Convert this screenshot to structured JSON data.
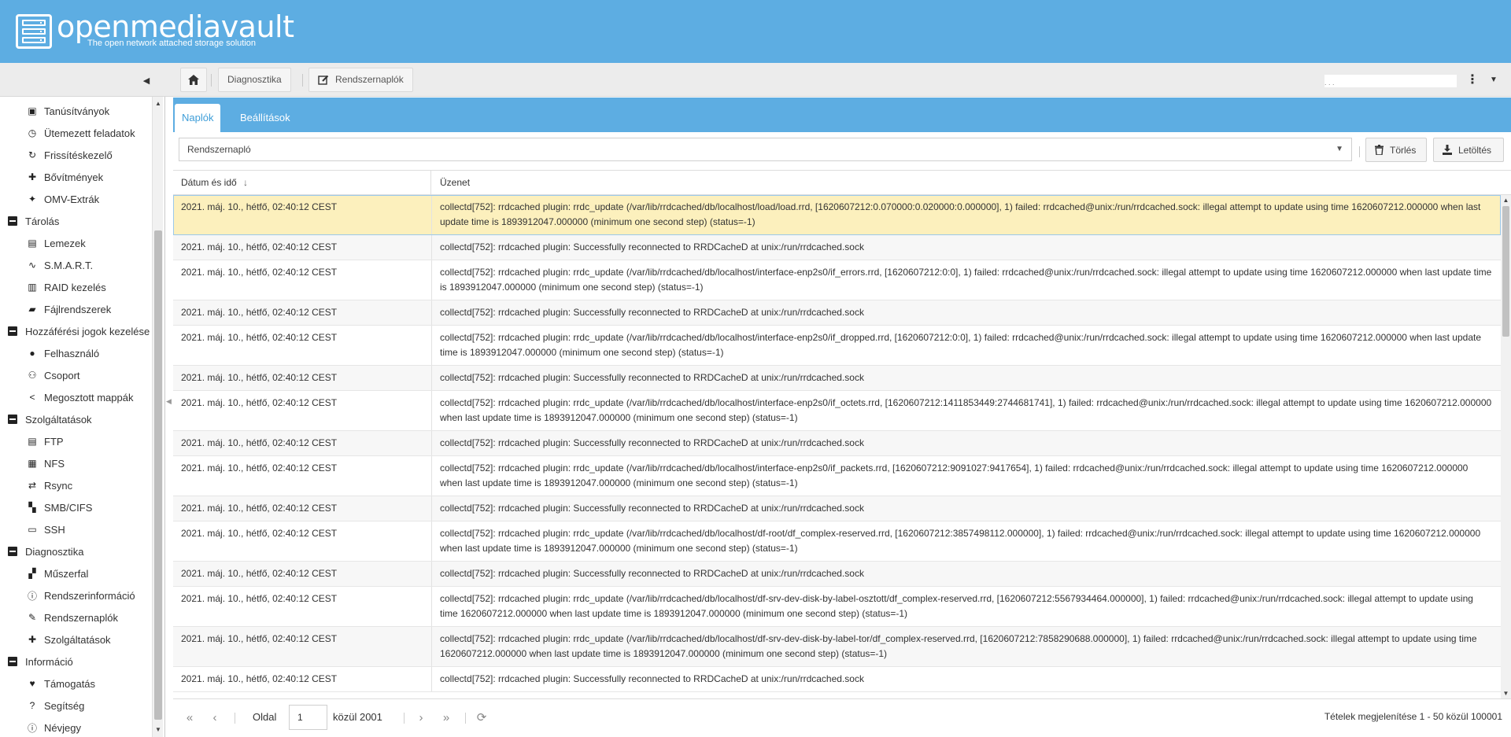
{
  "brand": {
    "name": "openmediavault",
    "tagline": "The open network attached storage solution"
  },
  "breadcrumb": [
    "Diagnosztika",
    "Rendszernaplók"
  ],
  "user": {
    "display": ". .                                            ."
  },
  "sidebar": {
    "items": [
      {
        "type": "child",
        "label": "Tanúsítványok",
        "icon": "certificate-icon"
      },
      {
        "type": "child",
        "label": "Ütemezett feladatok",
        "icon": "calendar-clock-icon"
      },
      {
        "type": "child",
        "label": "Frissítéskezelő",
        "icon": "refresh-icon"
      },
      {
        "type": "child",
        "label": "Bővítmények",
        "icon": "puzzle-icon"
      },
      {
        "type": "child",
        "label": "OMV-Extrák",
        "icon": "wand-icon"
      },
      {
        "type": "group",
        "label": "Tárolás"
      },
      {
        "type": "child",
        "label": "Lemezek",
        "icon": "disk-icon"
      },
      {
        "type": "child",
        "label": "S.M.A.R.T.",
        "icon": "pulse-icon"
      },
      {
        "type": "child",
        "label": "RAID kezelés",
        "icon": "raid-icon"
      },
      {
        "type": "child",
        "label": "Fájlrendszerek",
        "icon": "folders-icon"
      },
      {
        "type": "group",
        "label": "Hozzáférési jogok kezelése"
      },
      {
        "type": "child",
        "label": "Felhasználó",
        "icon": "user-icon"
      },
      {
        "type": "child",
        "label": "Csoport",
        "icon": "group-icon"
      },
      {
        "type": "child",
        "label": "Megosztott mappák",
        "icon": "share-icon"
      },
      {
        "type": "group",
        "label": "Szolgáltatások"
      },
      {
        "type": "child",
        "label": "FTP",
        "icon": "server-icon"
      },
      {
        "type": "child",
        "label": "NFS",
        "icon": "nfs-icon"
      },
      {
        "type": "child",
        "label": "Rsync",
        "icon": "rsync-icon"
      },
      {
        "type": "child",
        "label": "SMB/CIFS",
        "icon": "windows-icon"
      },
      {
        "type": "child",
        "label": "SSH",
        "icon": "terminal-icon"
      },
      {
        "type": "group",
        "label": "Diagnosztika"
      },
      {
        "type": "child",
        "label": "Műszerfal",
        "icon": "dashboard-icon"
      },
      {
        "type": "child",
        "label": "Rendszerinformáció",
        "icon": "info-icon"
      },
      {
        "type": "child",
        "label": "Rendszernaplók",
        "icon": "edit-icon"
      },
      {
        "type": "child",
        "label": "Szolgáltatások",
        "icon": "wrench-icon"
      },
      {
        "type": "group",
        "label": "Információ"
      },
      {
        "type": "child",
        "label": "Támogatás",
        "icon": "heart-icon"
      },
      {
        "type": "child",
        "label": "Segítség",
        "icon": "help-icon"
      },
      {
        "type": "child",
        "label": "Névjegy",
        "icon": "info-icon"
      }
    ]
  },
  "tabs": {
    "logs": "Naplók",
    "settings": "Beállítások"
  },
  "filter": {
    "selected_log": "Rendszernapló",
    "delete_label": "Törlés",
    "download_label": "Letöltés"
  },
  "grid": {
    "col_date": "Dátum és idő",
    "col_message": "Üzenet",
    "rows": [
      {
        "date": "2021. máj. 10., hétfő, 02:40:12 CEST",
        "message": "collectd[752]: rrdcached plugin: rrdc_update (/var/lib/rrdcached/db/localhost/load/load.rrd, [1620607212:0.070000:0.020000:0.000000], 1) failed: rrdcached@unix:/run/rrdcached.sock: illegal attempt to update using time 1620607212.000000 when last update time is 1893912047.000000 (minimum one second step) (status=-1)",
        "selected": true
      },
      {
        "date": "2021. máj. 10., hétfő, 02:40:12 CEST",
        "message": "collectd[752]: rrdcached plugin: Successfully reconnected to RRDCacheD at unix:/run/rrdcached.sock"
      },
      {
        "date": "2021. máj. 10., hétfő, 02:40:12 CEST",
        "message": "collectd[752]: rrdcached plugin: rrdc_update (/var/lib/rrdcached/db/localhost/interface-enp2s0/if_errors.rrd, [1620607212:0:0], 1) failed: rrdcached@unix:/run/rrdcached.sock: illegal attempt to update using time 1620607212.000000 when last update time is 1893912047.000000 (minimum one second step) (status=-1)"
      },
      {
        "date": "2021. máj. 10., hétfő, 02:40:12 CEST",
        "message": "collectd[752]: rrdcached plugin: Successfully reconnected to RRDCacheD at unix:/run/rrdcached.sock"
      },
      {
        "date": "2021. máj. 10., hétfő, 02:40:12 CEST",
        "message": "collectd[752]: rrdcached plugin: rrdc_update (/var/lib/rrdcached/db/localhost/interface-enp2s0/if_dropped.rrd, [1620607212:0:0], 1) failed: rrdcached@unix:/run/rrdcached.sock: illegal attempt to update using time 1620607212.000000 when last update time is 1893912047.000000 (minimum one second step) (status=-1)"
      },
      {
        "date": "2021. máj. 10., hétfő, 02:40:12 CEST",
        "message": "collectd[752]: rrdcached plugin: Successfully reconnected to RRDCacheD at unix:/run/rrdcached.sock"
      },
      {
        "date": "2021. máj. 10., hétfő, 02:40:12 CEST",
        "message": "collectd[752]: rrdcached plugin: rrdc_update (/var/lib/rrdcached/db/localhost/interface-enp2s0/if_octets.rrd, [1620607212:1411853449:2744681741], 1) failed: rrdcached@unix:/run/rrdcached.sock: illegal attempt to update using time 1620607212.000000 when last update time is 1893912047.000000 (minimum one second step) (status=-1)"
      },
      {
        "date": "2021. máj. 10., hétfő, 02:40:12 CEST",
        "message": "collectd[752]: rrdcached plugin: Successfully reconnected to RRDCacheD at unix:/run/rrdcached.sock"
      },
      {
        "date": "2021. máj. 10., hétfő, 02:40:12 CEST",
        "message": "collectd[752]: rrdcached plugin: rrdc_update (/var/lib/rrdcached/db/localhost/interface-enp2s0/if_packets.rrd, [1620607212:9091027:9417654], 1) failed: rrdcached@unix:/run/rrdcached.sock: illegal attempt to update using time 1620607212.000000 when last update time is 1893912047.000000 (minimum one second step) (status=-1)"
      },
      {
        "date": "2021. máj. 10., hétfő, 02:40:12 CEST",
        "message": "collectd[752]: rrdcached plugin: Successfully reconnected to RRDCacheD at unix:/run/rrdcached.sock"
      },
      {
        "date": "2021. máj. 10., hétfő, 02:40:12 CEST",
        "message": "collectd[752]: rrdcached plugin: rrdc_update (/var/lib/rrdcached/db/localhost/df-root/df_complex-reserved.rrd, [1620607212:3857498112.000000], 1) failed: rrdcached@unix:/run/rrdcached.sock: illegal attempt to update using time 1620607212.000000 when last update time is 1893912047.000000 (minimum one second step) (status=-1)"
      },
      {
        "date": "2021. máj. 10., hétfő, 02:40:12 CEST",
        "message": "collectd[752]: rrdcached plugin: Successfully reconnected to RRDCacheD at unix:/run/rrdcached.sock"
      },
      {
        "date": "2021. máj. 10., hétfő, 02:40:12 CEST",
        "message": "collectd[752]: rrdcached plugin: rrdc_update (/var/lib/rrdcached/db/localhost/df-srv-dev-disk-by-label-osztott/df_complex-reserved.rrd, [1620607212:5567934464.000000], 1) failed: rrdcached@unix:/run/rrdcached.sock: illegal attempt to update using time 1620607212.000000 when last update time is 1893912047.000000 (minimum one second step) (status=-1)"
      },
      {
        "date": "2021. máj. 10., hétfő, 02:40:12 CEST",
        "message": "collectd[752]: rrdcached plugin: rrdc_update (/var/lib/rrdcached/db/localhost/df-srv-dev-disk-by-label-tor/df_complex-reserved.rrd, [1620607212:7858290688.000000], 1) failed: rrdcached@unix:/run/rrdcached.sock: illegal attempt to update using time 1620607212.000000 when last update time is 1893912047.000000 (minimum one second step) (status=-1)"
      },
      {
        "date": "2021. máj. 10., hétfő, 02:40:12 CEST",
        "message": "collectd[752]: rrdcached plugin: Successfully reconnected to RRDCacheD at unix:/run/rrdcached.sock"
      }
    ]
  },
  "pager": {
    "page_label": "Oldal",
    "page_value": "1",
    "of_label": "közül 2001",
    "summary": "Tételek megjelenítése 1 - 50 közül 100001"
  },
  "colors": {
    "header_blue": "#5dade2",
    "tab_active_text": "#3f9ed8",
    "row_selected": "#fcf0bd"
  }
}
